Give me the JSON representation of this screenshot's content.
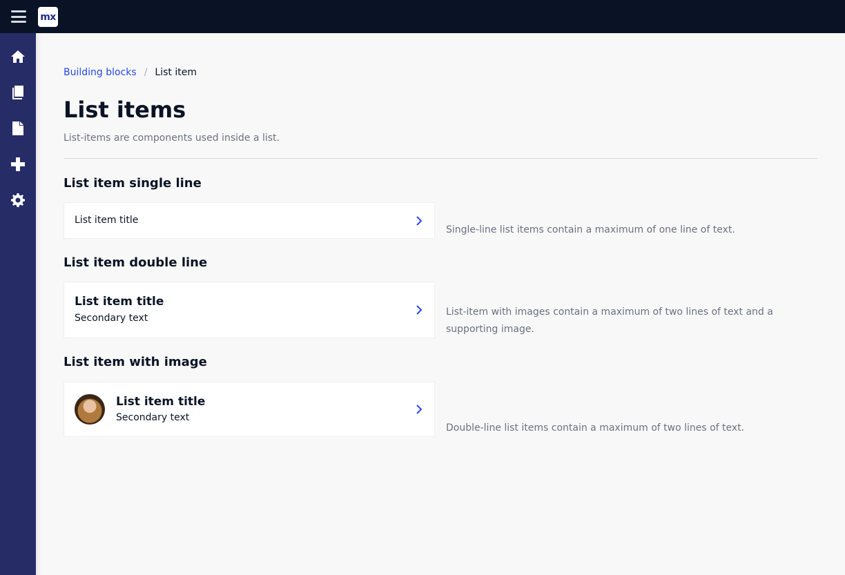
{
  "app": {
    "logo_text": "mx"
  },
  "sidebar": {
    "items": [
      {
        "icon": "home-icon"
      },
      {
        "icon": "book-icon"
      },
      {
        "icon": "document-icon"
      },
      {
        "icon": "plus-icon"
      },
      {
        "icon": "gear-icon"
      }
    ]
  },
  "breadcrumb": {
    "parent": "Building blocks",
    "separator": "/",
    "current": "List item"
  },
  "page": {
    "title": "List items",
    "subtitle": "List-items are components used inside a list."
  },
  "sections": {
    "single": {
      "heading": "List item single line",
      "item_title": "List item title",
      "description": "Single-line list items contain a maximum of one line of text."
    },
    "double": {
      "heading": "List item double line",
      "item_title": "List item title",
      "item_secondary": "Secondary text",
      "description": "List-item with images contain a maximum of two lines of text and a supporting image."
    },
    "image": {
      "heading": "List item with image",
      "item_title": "List item title",
      "item_secondary": "Secondary text",
      "description": "Double-line list items contain a maximum of two lines of text."
    }
  },
  "colors": {
    "topbar": "#0a1326",
    "sidebar": "#252c66",
    "accent": "#264ae5"
  }
}
